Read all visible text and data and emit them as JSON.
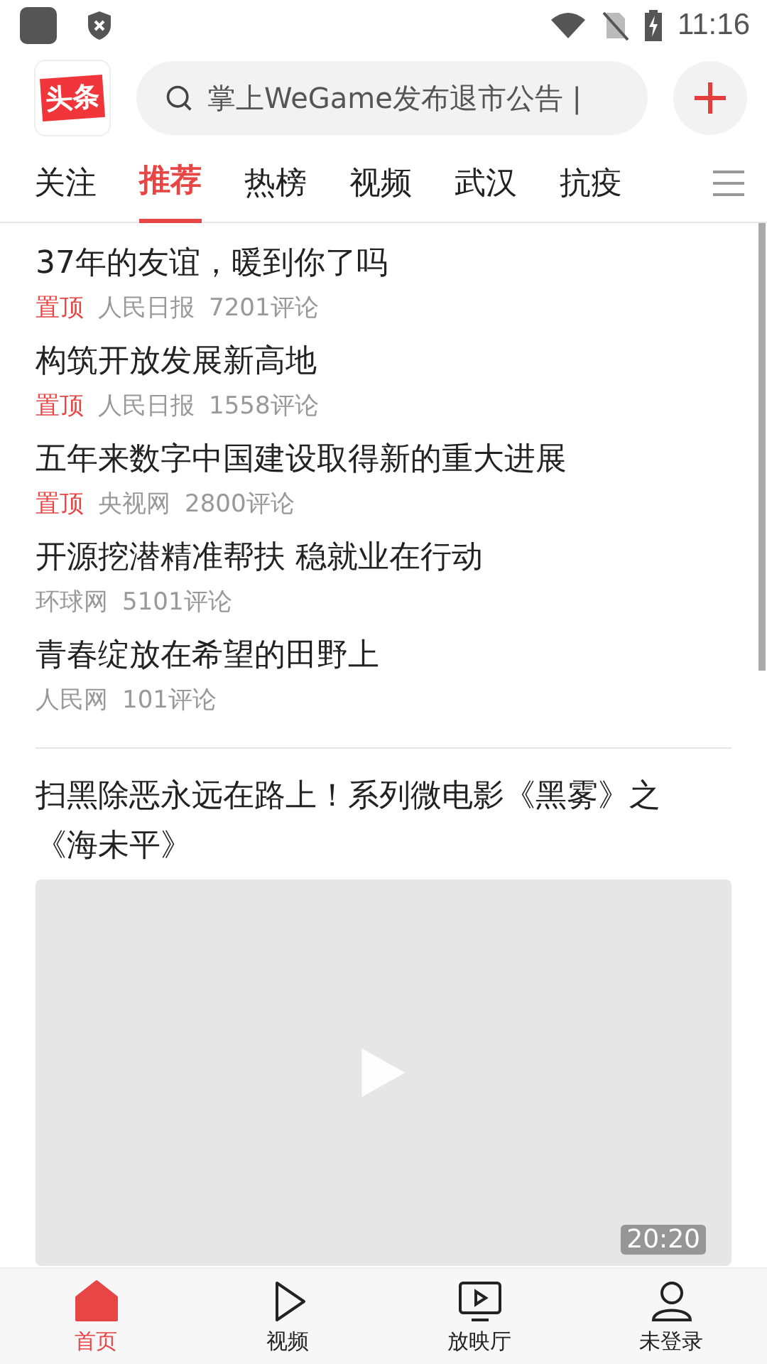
{
  "status_bar": {
    "time": "11:16"
  },
  "header": {
    "logo": "头条",
    "search": {
      "placeholder": "掌上WeGame发布退市公告 |"
    }
  },
  "tabs": [
    {
      "label": "关注",
      "selected": false
    },
    {
      "label": "推荐",
      "selected": true
    },
    {
      "label": "热榜",
      "selected": false
    },
    {
      "label": "视频",
      "selected": false
    },
    {
      "label": "武汉",
      "selected": false
    },
    {
      "label": "抗疫",
      "selected": false
    }
  ],
  "news": [
    {
      "title": "37年的友谊，暖到你了吗",
      "pinned": true,
      "pin_label": "置顶",
      "source": "人民日报",
      "comments": "7201评论"
    },
    {
      "title": "构筑开放发展新高地",
      "pinned": true,
      "pin_label": "置顶",
      "source": "人民日报",
      "comments": "1558评论"
    },
    {
      "title": "五年来数字中国建设取得新的重大进展",
      "pinned": true,
      "pin_label": "置顶",
      "source": "央视网",
      "comments": "2800评论"
    },
    {
      "title": "开源挖潜精准帮扶 稳就业在行动",
      "pinned": false,
      "source": "环球网",
      "comments": "5101评论"
    },
    {
      "title": "青春绽放在希望的田野上",
      "pinned": false,
      "source": "人民网",
      "comments": "101评论"
    }
  ],
  "video_card": {
    "title": "扫黑除恶永远在路上！系列微电影《黑雾》之《海未平》",
    "duration": "20:20"
  },
  "bottom_nav": [
    {
      "kind": "home",
      "label": "首页",
      "selected": true
    },
    {
      "kind": "video",
      "label": "视频",
      "selected": false
    },
    {
      "kind": "tv",
      "label": "放映厅",
      "selected": false
    },
    {
      "kind": "user",
      "label": "未登录",
      "selected": false
    }
  ]
}
